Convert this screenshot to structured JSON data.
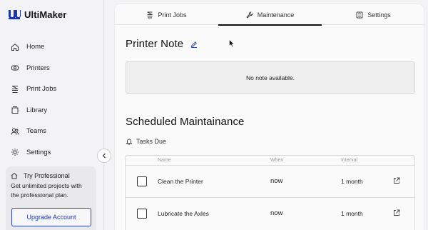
{
  "brand": {
    "name": "UltiMaker"
  },
  "sidebar": {
    "items": [
      {
        "label": "Home",
        "icon": "home-icon"
      },
      {
        "label": "Printers",
        "icon": "printer-icon"
      },
      {
        "label": "Print Jobs",
        "icon": "print-jobs-icon"
      },
      {
        "label": "Library",
        "icon": "library-icon"
      },
      {
        "label": "Teams",
        "icon": "teams-icon"
      },
      {
        "label": "Settings",
        "icon": "settings-icon"
      }
    ],
    "promo": {
      "title": "Try Professional",
      "text": "Get unlimited projects with the professional plan.",
      "button_label": "Upgrade Account"
    }
  },
  "tabs": [
    {
      "label": "Print Jobs",
      "icon": "print-jobs-icon",
      "active": false
    },
    {
      "label": "Maintenance",
      "icon": "wrench-icon",
      "active": true
    },
    {
      "label": "Settings",
      "icon": "settings-sliders-icon",
      "active": false
    }
  ],
  "printer_note": {
    "title": "Printer Note",
    "empty_text": "No note available."
  },
  "maintenance": {
    "title": "Scheduled Maintainance",
    "tasks_due_label": "Tasks Due",
    "columns": {
      "name": "Name",
      "when": "When",
      "interval": "Interval"
    },
    "rows": [
      {
        "name": "Clean the Printer",
        "when": "now",
        "interval": "1 month"
      },
      {
        "name": "Lubricate the Axles",
        "when": "now",
        "interval": "1 month"
      }
    ]
  },
  "colors": {
    "accent": "#1f3797",
    "brand_blue": "#2036a8"
  }
}
